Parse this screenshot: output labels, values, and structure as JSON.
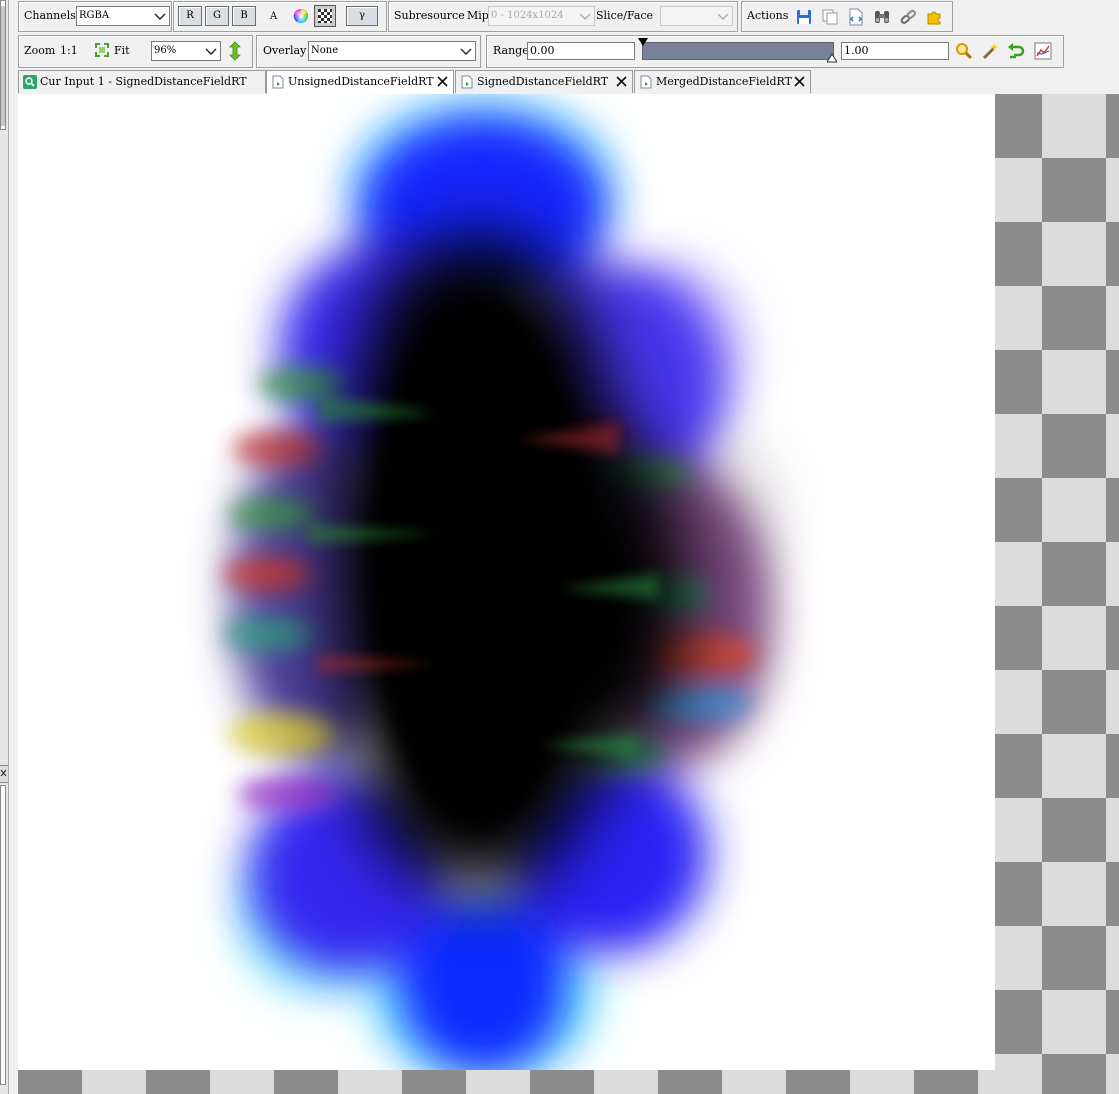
{
  "toolbar1": {
    "channels_label": "Channels",
    "channels_value": "RGBA",
    "channel_buttons": [
      "R",
      "G",
      "B"
    ],
    "alpha_label": "A",
    "gamma_label": "γ",
    "subresource_label": "Subresource",
    "mip_label": "Mip",
    "mip_value": "0 - 1024x1024",
    "slice_label": "Slice/Face",
    "slice_value": "",
    "actions_label": "Actions"
  },
  "toolbar2": {
    "zoom_label": "Zoom",
    "zoom_1to1": "1:1",
    "fit_label": "Fit",
    "zoom_value": "96%",
    "overlay_label": "Overlay",
    "overlay_value": "None",
    "range_label": "Range",
    "range_min": "0.00",
    "range_max": "1.00"
  },
  "tabs": [
    {
      "label": "Cur Input 1 - SignedDistanceFieldRT",
      "active": false,
      "closable": false
    },
    {
      "label": "UnsignedDistanceFieldRT",
      "active": true,
      "closable": true
    },
    {
      "label": "SignedDistanceFieldRT",
      "active": false,
      "closable": true
    },
    {
      "label": "MergedDistanceFieldRT",
      "active": false,
      "closable": true
    }
  ],
  "icons": {
    "color_wheel": "color-wheel-icon",
    "checkerboard": "checkerboard-icon",
    "save": "save-icon",
    "copy": "copy-icon",
    "open_in_viewer": "open-resource-icon",
    "find": "binoculars-icon",
    "pixel_context": "link-icon",
    "extensions": "puzzle-icon",
    "fit": "fit-window-icon",
    "flip": "vertical-arrows-icon",
    "zoom_range": "magnifier-icon",
    "autofit": "wand-icon",
    "reset": "undo-arrow-icon",
    "histogram": "histogram-icon",
    "cur_input": "search-tab-icon",
    "texture_tab": "texture-tab-icon",
    "close": "close-icon"
  },
  "colors": {
    "accent_blue": "#1428ff",
    "checker_dark": "#8c8c8c",
    "checker_light": "#dcdcdc",
    "range_bar": "#778296"
  }
}
